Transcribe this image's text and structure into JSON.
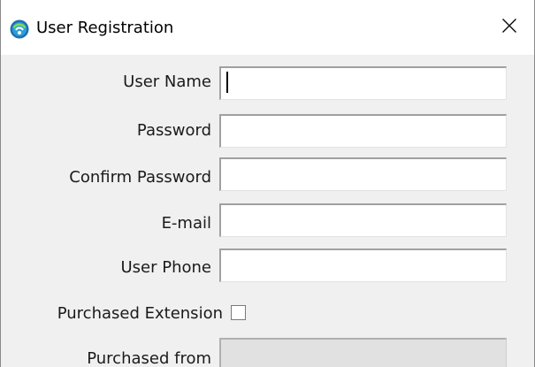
{
  "window": {
    "title": "User Registration",
    "icon": "app-globe-icon",
    "close_icon": "close-icon"
  },
  "form": {
    "username_label": "User Name",
    "username_value": "",
    "password_label": "Password",
    "password_value": "",
    "confirm_password_label": "Confirm Password",
    "confirm_password_value": "",
    "email_label": "E-mail",
    "email_value": "",
    "phone_label": "User Phone",
    "phone_value": "",
    "purchased_extension_label": "Purchased Extension",
    "purchased_extension_checked": false,
    "purchased_from_label": "Purchased from",
    "purchased_from_value": ""
  }
}
